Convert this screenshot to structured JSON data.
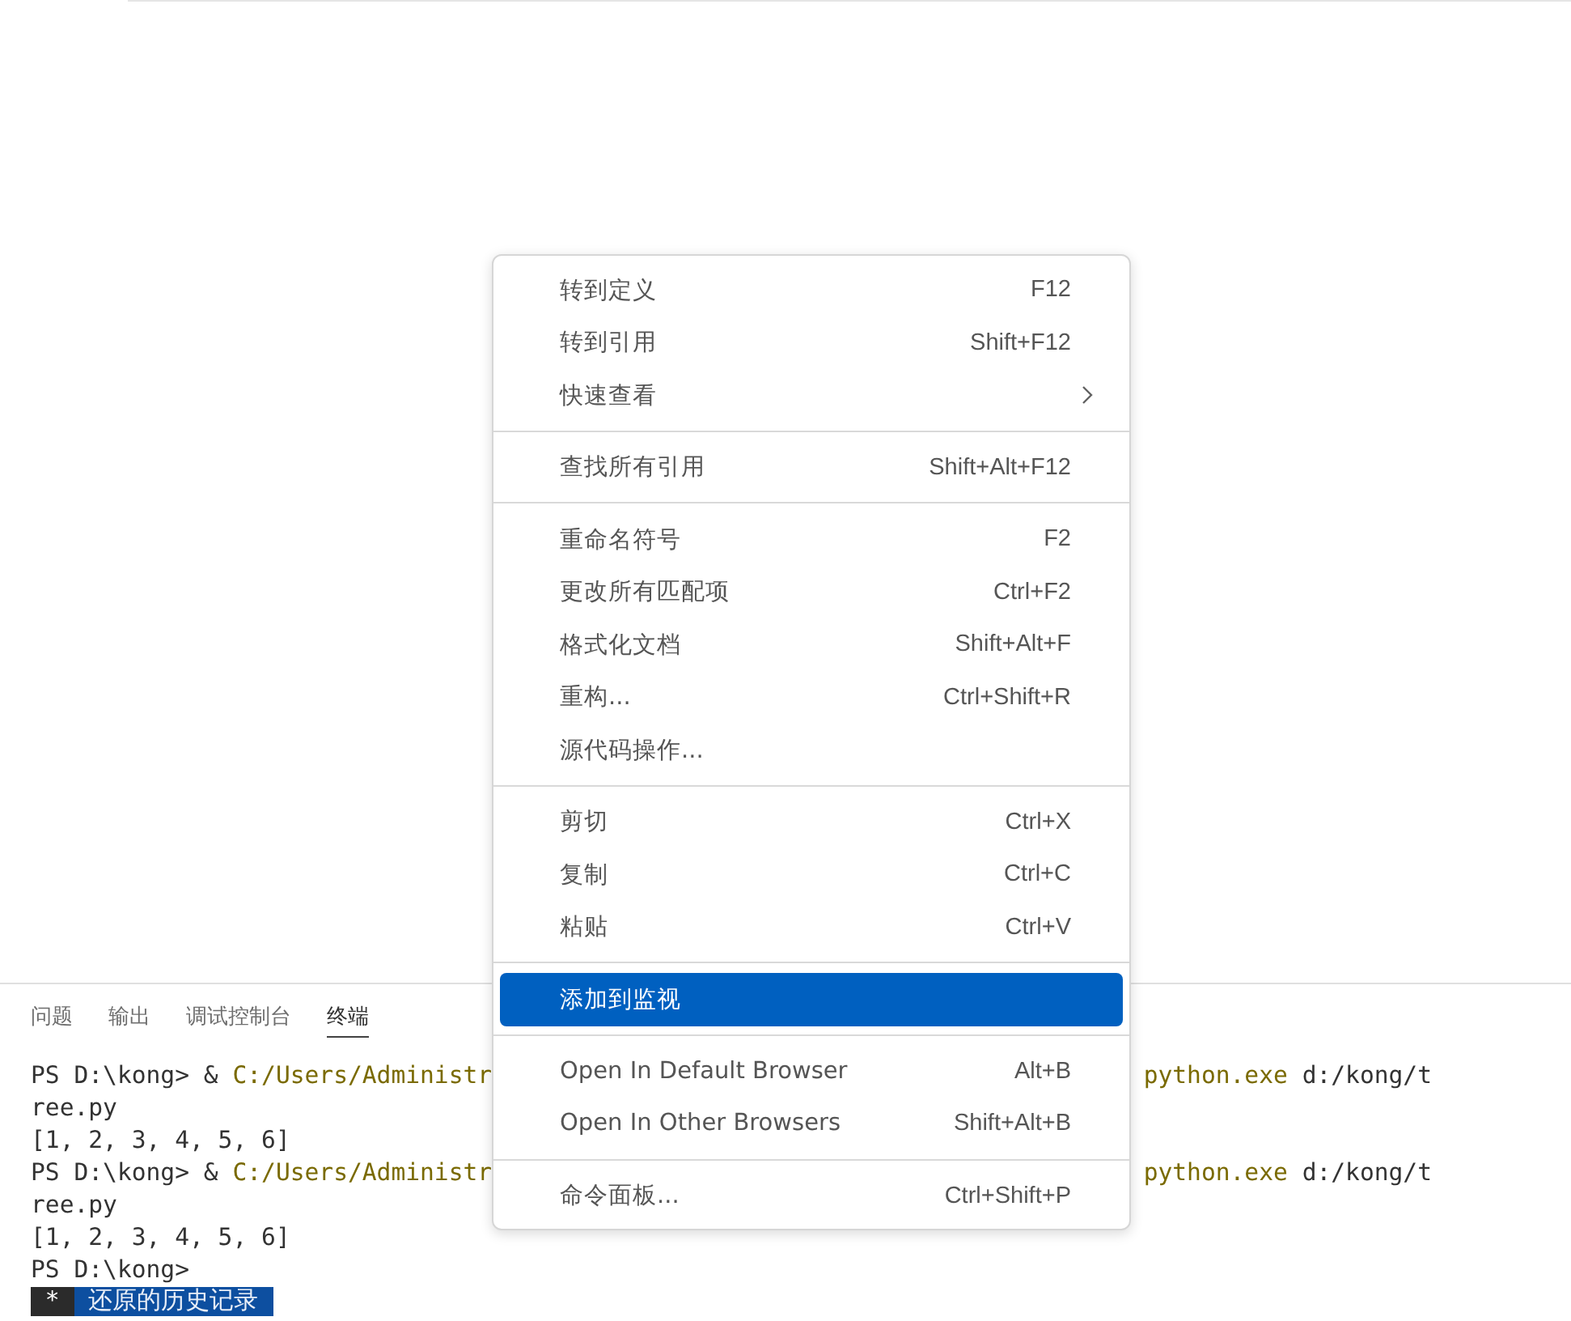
{
  "panel": {
    "tabs": [
      {
        "label": "问题",
        "selected": false
      },
      {
        "label": "输出",
        "selected": false
      },
      {
        "label": "调试控制台",
        "selected": false
      },
      {
        "label": "终端",
        "selected": true
      }
    ]
  },
  "terminal": {
    "lines": [
      {
        "segments": [
          {
            "kind": "plain",
            "text": "PS D:\\kong> & "
          },
          {
            "kind": "path",
            "text": "C:/Users/Administr"
          }
        ],
        "tail": [
          {
            "kind": "path",
            "text": "python.exe"
          },
          {
            "kind": "plain",
            "text": " d:/kong/t"
          }
        ]
      },
      {
        "segments": [
          {
            "kind": "plain",
            "text": "ree.py"
          }
        ]
      },
      {
        "segments": [
          {
            "kind": "plain",
            "text": "[1, 2, 3, 4, 5, 6]"
          }
        ]
      },
      {
        "segments": [
          {
            "kind": "plain",
            "text": "PS D:\\kong> & "
          },
          {
            "kind": "path",
            "text": "C:/Users/Administr"
          }
        ],
        "tail": [
          {
            "kind": "path",
            "text": "python.exe"
          },
          {
            "kind": "plain",
            "text": " d:/kong/t"
          }
        ]
      },
      {
        "segments": [
          {
            "kind": "plain",
            "text": "ree.py"
          }
        ]
      },
      {
        "segments": [
          {
            "kind": "plain",
            "text": "[1, 2, 3, 4, 5, 6]"
          }
        ]
      },
      {
        "segments": [
          {
            "kind": "plain",
            "text": "PS D:\\kong>"
          }
        ]
      },
      {
        "segments": [
          {
            "kind": "mark",
            "text": " * "
          },
          {
            "kind": "notice",
            "text": " 还原的历史记录 "
          }
        ]
      }
    ]
  },
  "context_menu": {
    "groups": [
      [
        {
          "label": "转到定义",
          "shortcut": "F12",
          "selected": false
        },
        {
          "label": "转到引用",
          "shortcut": "Shift+F12",
          "selected": false
        },
        {
          "label": "快速查看",
          "submenu": true,
          "selected": false
        }
      ],
      [
        {
          "label": "查找所有引用",
          "shortcut": "Shift+Alt+F12",
          "selected": false
        }
      ],
      [
        {
          "label": "重命名符号",
          "shortcut": "F2",
          "selected": false
        },
        {
          "label": "更改所有匹配项",
          "shortcut": "Ctrl+F2",
          "selected": false
        },
        {
          "label": "格式化文档",
          "shortcut": "Shift+Alt+F",
          "selected": false
        },
        {
          "label": "重构...",
          "shortcut": "Ctrl+Shift+R",
          "selected": false
        },
        {
          "label": "源代码操作...",
          "selected": false
        }
      ],
      [
        {
          "label": "剪切",
          "shortcut": "Ctrl+X",
          "selected": false
        },
        {
          "label": "复制",
          "shortcut": "Ctrl+C",
          "selected": false
        },
        {
          "label": "粘贴",
          "shortcut": "Ctrl+V",
          "selected": false
        }
      ],
      [
        {
          "label": "添加到监视",
          "selected": true
        }
      ],
      [
        {
          "label": "Open In Default Browser",
          "shortcut": "Alt+B",
          "selected": false
        },
        {
          "label": "Open In Other Browsers",
          "shortcut": "Shift+Alt+B",
          "selected": false
        }
      ],
      [
        {
          "label": "命令面板...",
          "shortcut": "Ctrl+Shift+P",
          "selected": false
        }
      ]
    ]
  }
}
